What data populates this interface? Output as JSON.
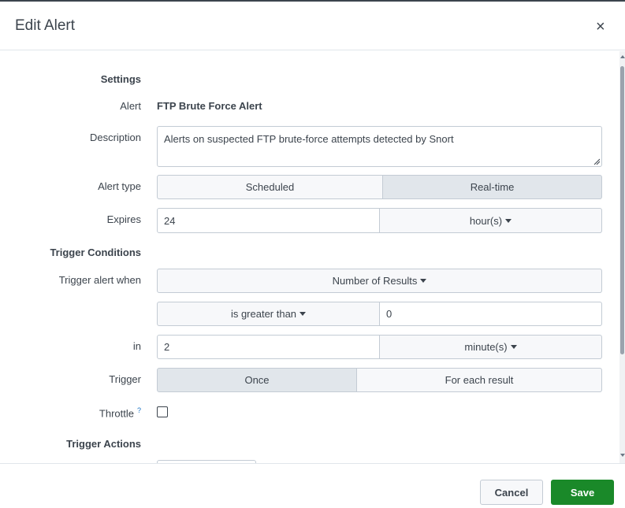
{
  "dialog": {
    "title": "Edit Alert",
    "close_symbol": "×"
  },
  "settings": {
    "section_label": "Settings",
    "alert_label": "Alert",
    "alert_value": "FTP Brute Force Alert",
    "description_label": "Description",
    "description_value": "Alerts on suspected FTP brute-force attempts detected by Snort",
    "alert_type_label": "Alert type",
    "alert_type_options": [
      "Scheduled",
      "Real-time"
    ],
    "alert_type_selected": "Real-time",
    "expires_label": "Expires",
    "expires_value": "24",
    "expires_unit": "hour(s)"
  },
  "trigger_conditions": {
    "section_label": "Trigger Conditions",
    "trigger_when_label": "Trigger alert when",
    "trigger_when_value": "Number of Results",
    "comparison_value": "is greater than",
    "threshold_value": "0",
    "in_label": "in",
    "in_value": "2",
    "in_unit": "minute(s)",
    "trigger_label": "Trigger",
    "trigger_options": [
      "Once",
      "For each result"
    ],
    "trigger_selected": "Once",
    "throttle_label": "Throttle",
    "throttle_help": "?",
    "throttle_checked": false
  },
  "trigger_actions": {
    "section_label": "Trigger Actions"
  },
  "footer": {
    "cancel_label": "Cancel",
    "save_label": "Save"
  },
  "colors": {
    "accent": "#1a8929",
    "text": "#3c444d",
    "border": "#c3cbd4",
    "selected_bg": "#e1e6eb"
  }
}
